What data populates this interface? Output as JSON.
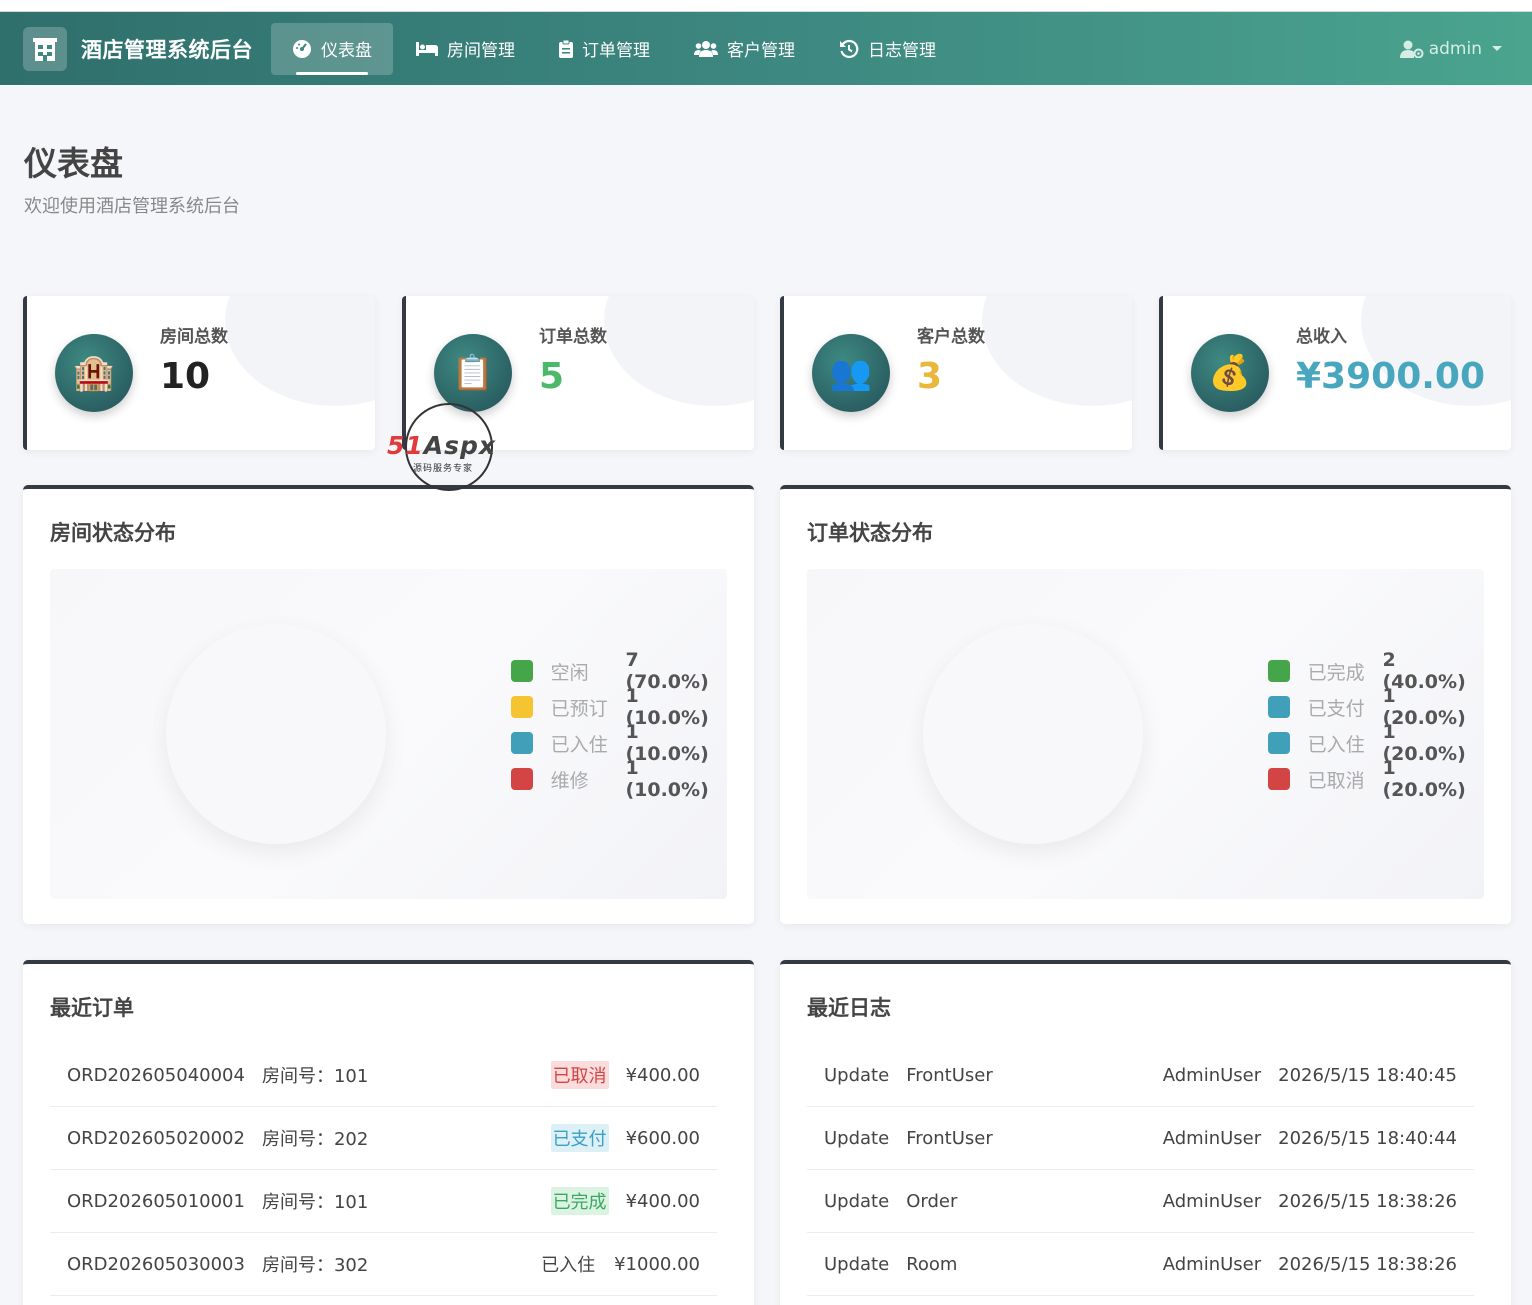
{
  "header": {
    "title": "酒店管理系统后台",
    "nav": [
      {
        "label": "仪表盘",
        "icon": "dashboard-icon",
        "active": true
      },
      {
        "label": "房间管理",
        "icon": "bed-icon"
      },
      {
        "label": "订单管理",
        "icon": "clipboard-icon"
      },
      {
        "label": "客户管理",
        "icon": "users-icon"
      },
      {
        "label": "日志管理",
        "icon": "history-icon"
      }
    ],
    "user": "admin"
  },
  "page": {
    "title": "仪表盘",
    "subtitle": "欢迎使用酒店管理系统后台"
  },
  "stats": [
    {
      "label": "房间总数",
      "value": "10",
      "color": "#222222",
      "icon": "hotel-icon",
      "emoji": "🏨"
    },
    {
      "label": "订单总数",
      "value": "5",
      "color": "#4cb86a",
      "icon": "clipboard-icon",
      "emoji": "📋"
    },
    {
      "label": "客户总数",
      "value": "3",
      "color": "#e9b83a",
      "icon": "users-icon",
      "emoji": "👥"
    },
    {
      "label": "总收入",
      "value": "¥3900.00",
      "color": "#48a7bf",
      "icon": "money-bag-icon",
      "emoji": "💰"
    }
  ],
  "watermark": {
    "brand_red": "51",
    "brand_dark": "Aspx",
    "sub": "源码服务专家"
  },
  "room_status": {
    "title": "房间状态分布",
    "legend": [
      {
        "label": "空闲",
        "value": "7 (70.0%)",
        "color": "#45a649"
      },
      {
        "label": "已预订",
        "value": "1 (10.0%)",
        "color": "#f4c431"
      },
      {
        "label": "已入住",
        "value": "1 (10.0%)",
        "color": "#409fb9"
      },
      {
        "label": "维修",
        "value": "1 (10.0%)",
        "color": "#d34545"
      }
    ]
  },
  "order_status": {
    "title": "订单状态分布",
    "legend": [
      {
        "label": "已完成",
        "value": "2 (40.0%)",
        "color": "#45a649"
      },
      {
        "label": "已支付",
        "value": "1 (20.0%)",
        "color": "#409fb9"
      },
      {
        "label": "已入住",
        "value": "1 (20.0%)",
        "color": "#409fb9"
      },
      {
        "label": "已取消",
        "value": "1 (20.0%)",
        "color": "#d34545"
      }
    ]
  },
  "recent_orders": {
    "title": "最近订单",
    "rows": [
      {
        "id": "ORD202605040004",
        "room": "房间号：101",
        "status": "已取消",
        "status_type": "cancel",
        "amount": "¥400.00"
      },
      {
        "id": "ORD202605020002",
        "room": "房间号：202",
        "status": "已支付",
        "status_type": "paid",
        "amount": "¥600.00"
      },
      {
        "id": "ORD202605010001",
        "room": "房间号：101",
        "status": "已完成",
        "status_type": "done",
        "amount": "¥400.00"
      },
      {
        "id": "ORD202605030003",
        "room": "房间号：302",
        "status": "已入住",
        "status_type": "in",
        "amount": "¥1000.00"
      }
    ]
  },
  "recent_logs": {
    "title": "最近日志",
    "rows": [
      {
        "action": "Update",
        "target": "FrontUser",
        "user": "AdminUser",
        "time": "2026/5/15 18:40:45"
      },
      {
        "action": "Update",
        "target": "FrontUser",
        "user": "AdminUser",
        "time": "2026/5/15 18:40:44"
      },
      {
        "action": "Update",
        "target": "Order",
        "user": "AdminUser",
        "time": "2026/5/15 18:38:26"
      },
      {
        "action": "Update",
        "target": "Room",
        "user": "AdminUser",
        "time": "2026/5/15 18:38:26"
      }
    ]
  }
}
